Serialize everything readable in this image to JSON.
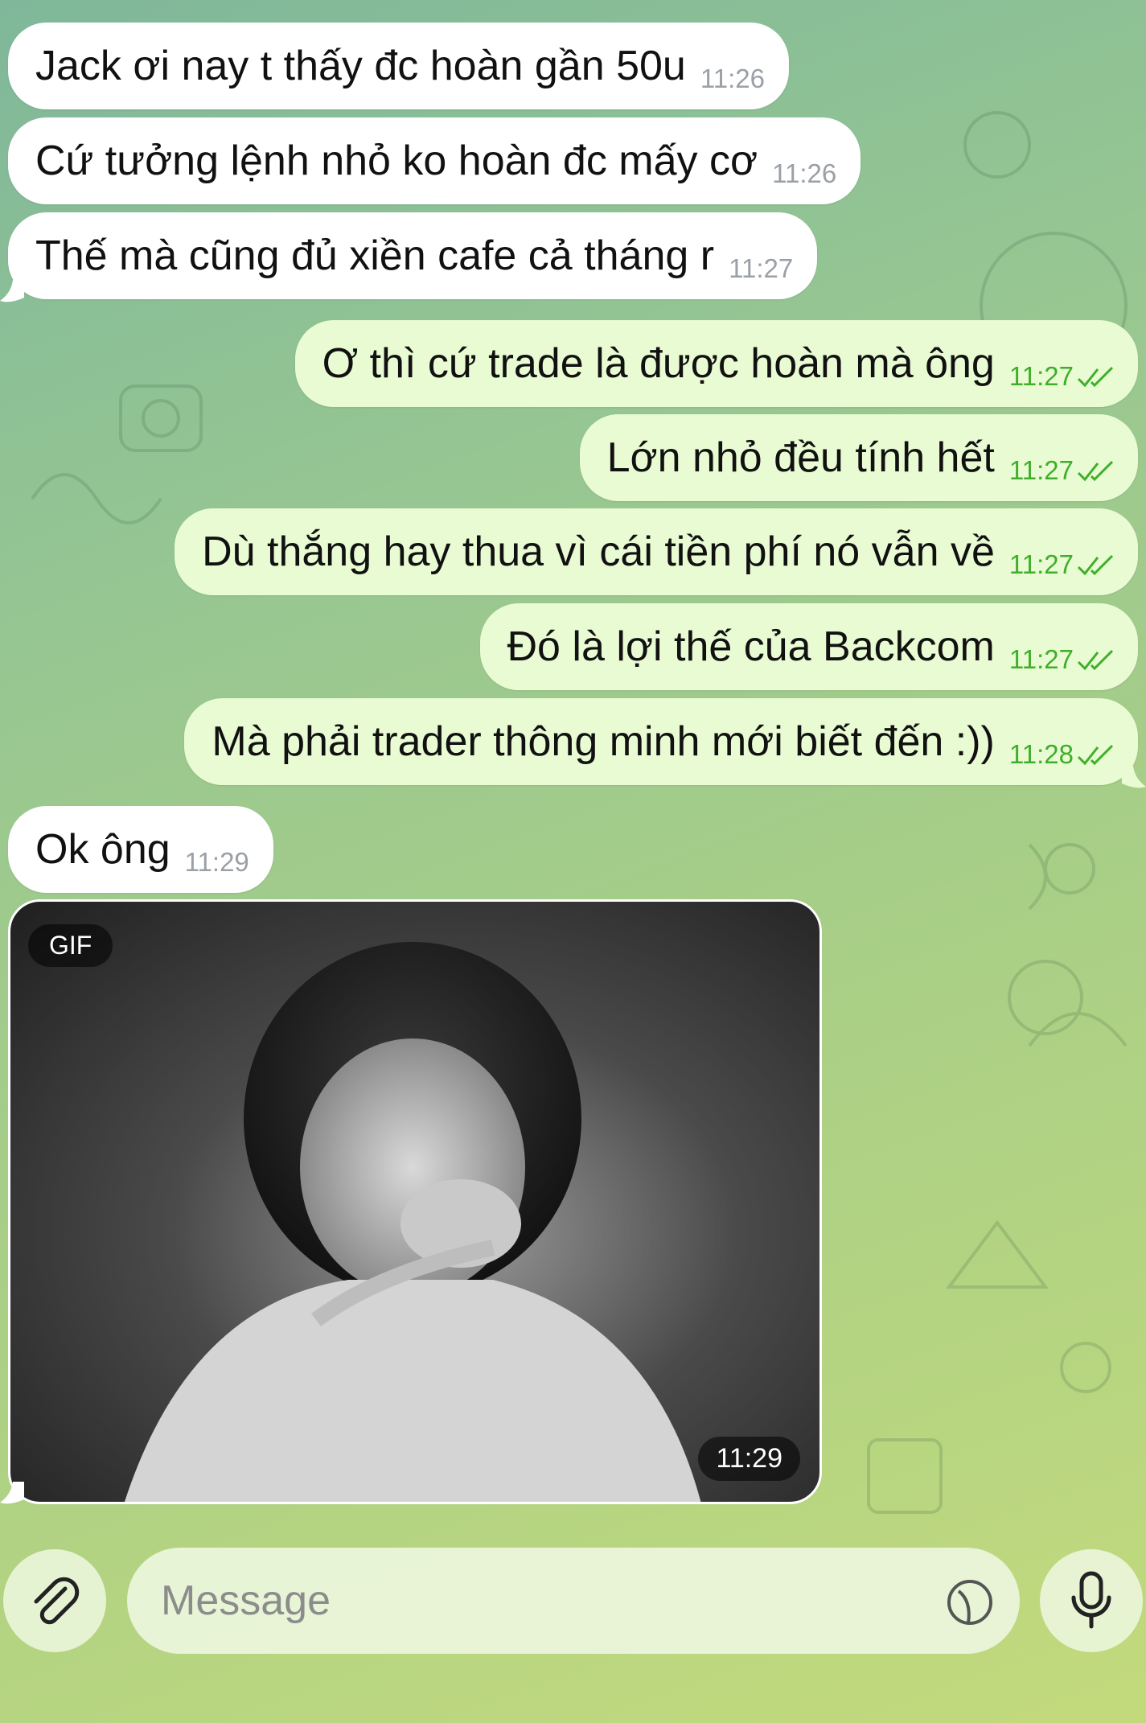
{
  "messages": [
    {
      "text": "Jack ơi nay t thấy đc hoàn gần 50u",
      "time": "11:26"
    },
    {
      "text": "Cứ tưởng lệnh nhỏ ko hoàn đc mấy cơ",
      "time": "11:26"
    },
    {
      "text": "Thế mà cũng đủ xiền cafe cả tháng r",
      "time": "11:27"
    },
    {
      "text": "Ơ thì cứ trade là được hoàn mà ông",
      "time": "11:27"
    },
    {
      "text": "Lớn nhỏ đều tính hết",
      "time": "11:27"
    },
    {
      "text": "Dù thắng hay thua vì cái tiền phí nó vẫn về",
      "time": "11:27"
    },
    {
      "text": "Đó là lợi thế của Backcom",
      "time": "11:27"
    },
    {
      "text": "Mà phải trader thông minh mới biết đến :))",
      "time": "11:28"
    },
    {
      "text": "Ok ông",
      "time": "11:29"
    }
  ],
  "gif": {
    "badge": "GIF",
    "time": "11:29"
  },
  "composer": {
    "placeholder": "Message"
  },
  "colors": {
    "incoming": "#ffffff",
    "outgoing": "#e9fbd3",
    "read_check": "#3fae2a"
  }
}
